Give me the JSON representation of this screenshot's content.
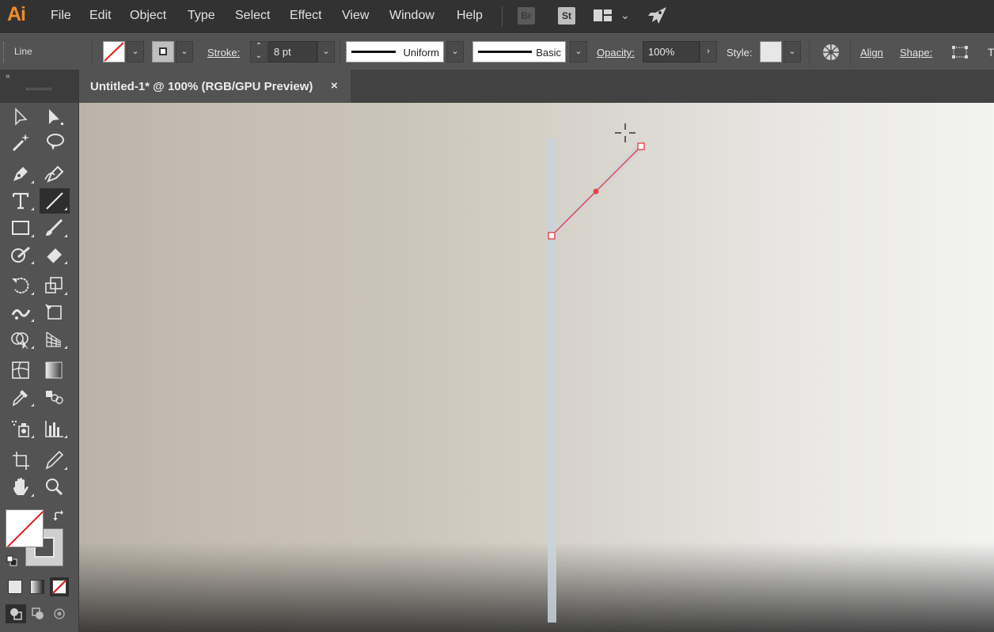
{
  "app": {
    "logo": "Ai"
  },
  "menu": [
    "File",
    "Edit",
    "Object",
    "Type",
    "Select",
    "Effect",
    "View",
    "Window",
    "Help"
  ],
  "app_buttons": {
    "bridge": "Br",
    "stock": "St"
  },
  "control_bar": {
    "selection_type": "Line",
    "stroke_label": "Stroke:",
    "stroke_weight": "8 pt",
    "variable_width_profile": "Uniform",
    "brush_definition": "Basic",
    "opacity_label": "Opacity:",
    "opacity_value": "100%",
    "style_label": "Style:",
    "align_label": "Align",
    "shape_label": "Shape:",
    "overflow_label": "T"
  },
  "document_tab": {
    "title": "Untitled-1* @ 100% (RGB/GPU Preview)",
    "close": "×"
  },
  "toolbox": {
    "collapse": "‹‹",
    "active_tool": "line-segment-tool"
  },
  "colors": {
    "accent": "#f08b2a",
    "path_selection": "#e8434a",
    "stroke_preview": "#c9d3dc"
  }
}
